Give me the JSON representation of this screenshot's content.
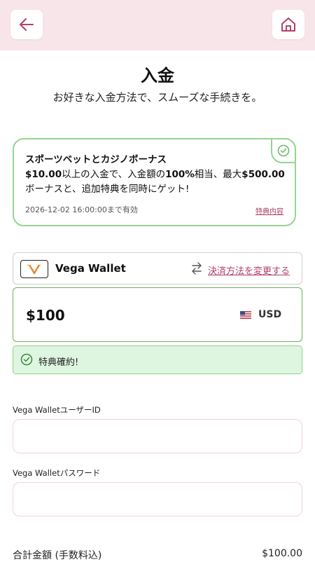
{
  "header": {
    "back_icon": "arrow-left-icon",
    "home_icon": "home-icon"
  },
  "page": {
    "title": "入金",
    "subtitle": "お好きな入金方法で、スムーズな手続きを。"
  },
  "promo": {
    "title": "スポーツベットとカジノボーナス",
    "desc_1": "$10.00",
    "desc_2": "以上の入金で、入金額の",
    "desc_3": "100%",
    "desc_4": "相当、最大",
    "desc_5": "$500.00",
    "desc_6": "ボーナスと、追加特典を同時にゲット!",
    "valid_until": "2026-12-02 16:00:00まで有効",
    "details_link": "特典内容",
    "selected": true
  },
  "payment": {
    "wallet_name": "Vega Wallet",
    "change_method": "決済方法を変更する",
    "amount": "$100",
    "currency": "USD"
  },
  "confirm": {
    "text": "特典確約!"
  },
  "form": {
    "user_id_label": "Vega WalletユーザーID",
    "user_id_value": "",
    "password_label": "Vega Walletパスワード",
    "password_value": ""
  },
  "total": {
    "label": "合計金額 (手数料込)",
    "value": "$100.00"
  },
  "colors": {
    "topbar": "#f7e5ea",
    "accent": "#b0406a",
    "promo_border": "#93d690",
    "confirm_bg": "#def6df"
  }
}
